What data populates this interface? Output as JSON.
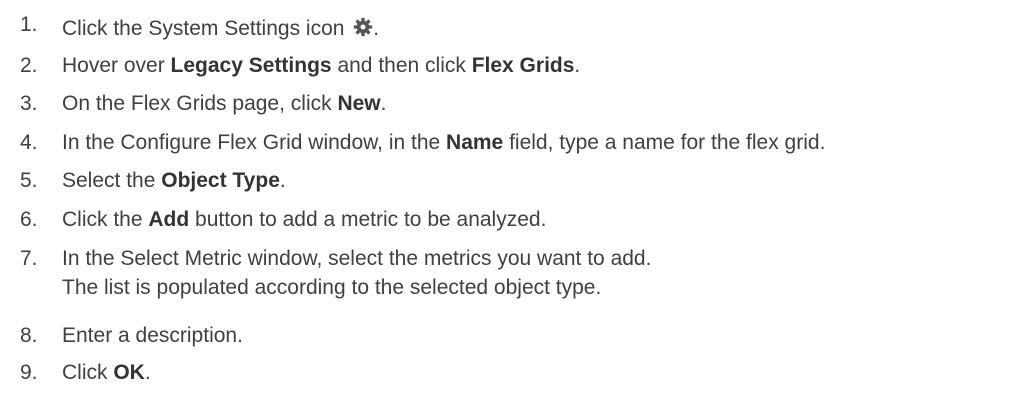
{
  "steps": [
    {
      "num": "1.",
      "parts": [
        {
          "t": "Click the System Settings icon "
        }
      ],
      "icon": "gear-icon",
      "after_icon": "."
    },
    {
      "num": "2.",
      "parts": [
        {
          "t": "Hover over "
        },
        {
          "t": "Legacy Settings",
          "b": true
        },
        {
          "t": " and then click "
        },
        {
          "t": "Flex Grids",
          "b": true
        },
        {
          "t": "."
        }
      ]
    },
    {
      "num": "3.",
      "parts": [
        {
          "t": "On the Flex Grids page, click "
        },
        {
          "t": "New",
          "b": true
        },
        {
          "t": "."
        }
      ]
    },
    {
      "num": "4.",
      "parts": [
        {
          "t": "In the Configure Flex Grid window, in the "
        },
        {
          "t": "Name",
          "b": true
        },
        {
          "t": " field, type a name for the flex grid."
        }
      ]
    },
    {
      "num": "5.",
      "parts": [
        {
          "t": "Select the "
        },
        {
          "t": "Object Type",
          "b": true
        },
        {
          "t": "."
        }
      ]
    },
    {
      "num": "6.",
      "parts": [
        {
          "t": "Click the "
        },
        {
          "t": "Add",
          "b": true
        },
        {
          "t": " button to add a metric to be analyzed."
        }
      ]
    },
    {
      "num": "7.",
      "parts": [
        {
          "t": "In the Select Metric window, select the metrics you want to add."
        }
      ],
      "second_line": "The list is populated according to the selected object type."
    },
    {
      "num": "8.",
      "parts": [
        {
          "t": "Enter a description."
        }
      ]
    },
    {
      "num": "9.",
      "parts": [
        {
          "t": "Click "
        },
        {
          "t": "OK",
          "b": true
        },
        {
          "t": "."
        }
      ]
    }
  ],
  "colors": {
    "text": "#404040",
    "icon": "#555555"
  }
}
